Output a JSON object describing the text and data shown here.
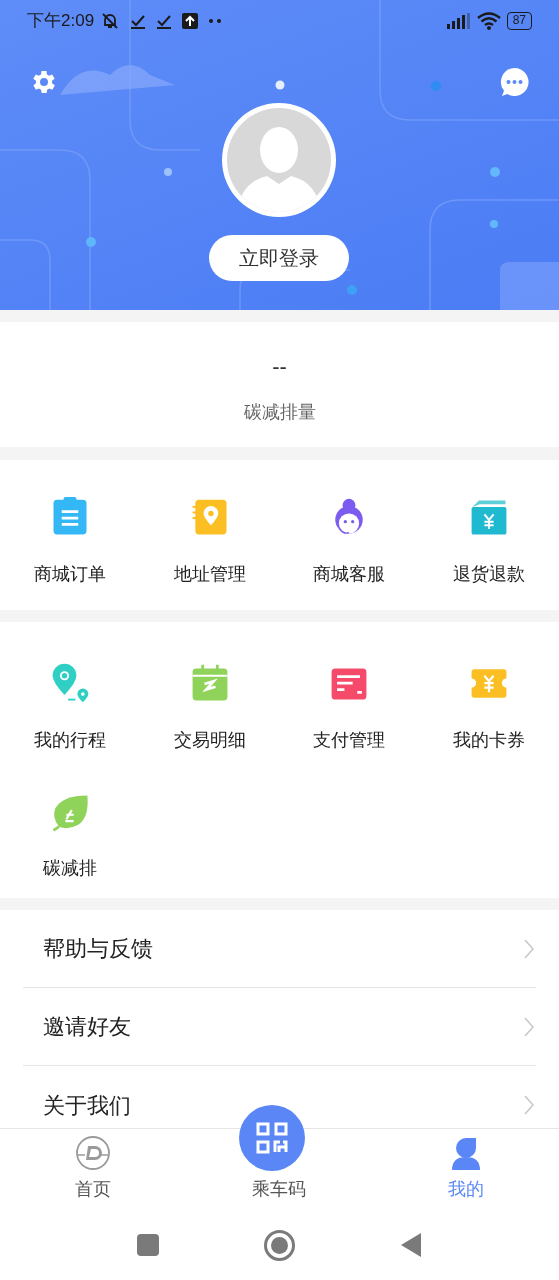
{
  "status_bar": {
    "time": "下午2:09",
    "battery": "87"
  },
  "header": {
    "login_button": "立即登录"
  },
  "carbon": {
    "value": "--",
    "label": "碳减排量"
  },
  "mall_services": [
    {
      "kind": "clipboard",
      "label": "商城订单"
    },
    {
      "kind": "address",
      "label": "地址管理"
    },
    {
      "kind": "agent",
      "label": "商城客服"
    },
    {
      "kind": "refund",
      "label": "退货退款"
    }
  ],
  "services": [
    {
      "kind": "trip",
      "label": "我的行程"
    },
    {
      "kind": "calendar",
      "label": "交易明细"
    },
    {
      "kind": "card",
      "label": "支付管理"
    },
    {
      "kind": "coupon",
      "label": "我的卡券"
    },
    {
      "kind": "leaf",
      "label": "碳减排"
    }
  ],
  "menu": [
    {
      "label": "帮助与反馈"
    },
    {
      "label": "邀请好友"
    },
    {
      "label": "关于我们"
    }
  ],
  "tabs": [
    {
      "kind": "home",
      "label": "首页",
      "selected": false
    },
    {
      "kind": "qr",
      "label": "乘车码",
      "selected": false
    },
    {
      "kind": "profile",
      "label": "我的",
      "selected": true
    }
  ]
}
